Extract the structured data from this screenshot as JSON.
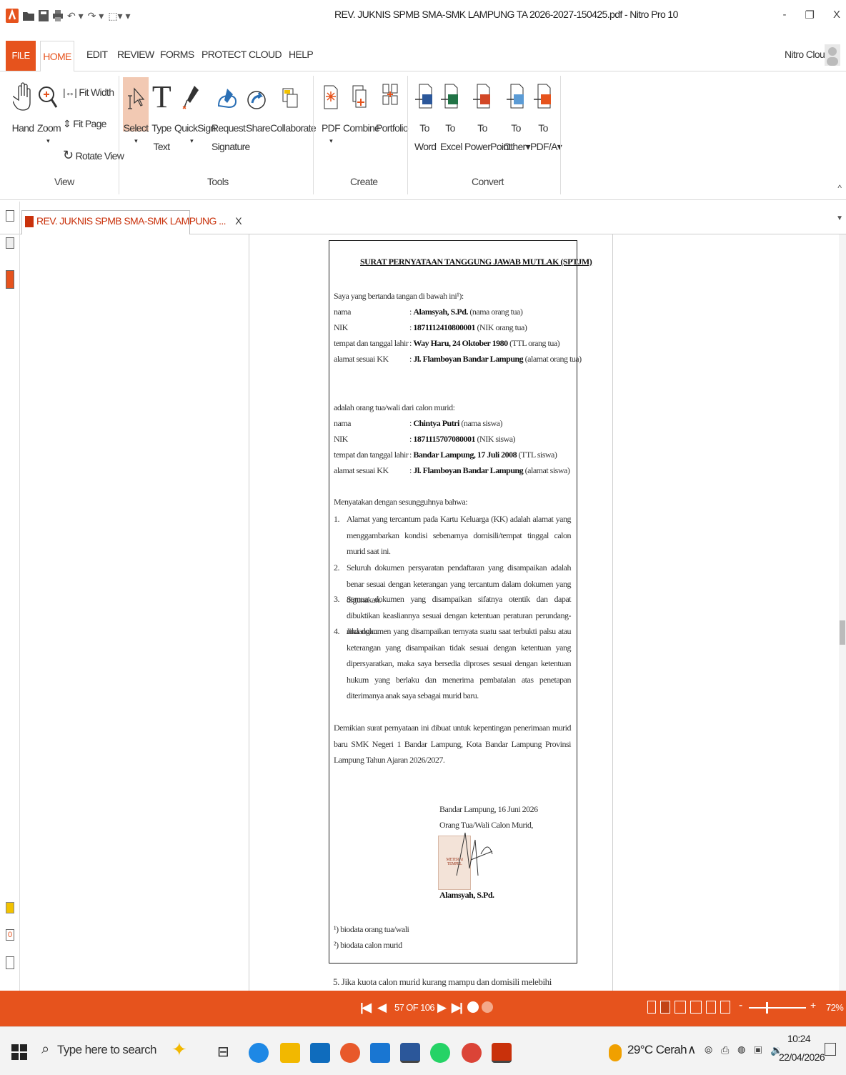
{
  "window": {
    "title": "REV. JUKNIS SPMB SMA-SMK LAMPUNG TA 2026-2027-150425.pdf - Nitro Pro 10",
    "minimize": "-",
    "restore": "❐",
    "close": "X"
  },
  "menu": {
    "file": "FILE",
    "tabs": [
      "HOME",
      "EDIT",
      "REVIEW",
      "FORMS",
      "PROTECT",
      "CLOUD",
      "HELP"
    ],
    "account": "Nitro Cloud"
  },
  "ribbon": {
    "view": {
      "label": "View",
      "hand": "Hand",
      "zoom": "Zoom",
      "fit_width": "Fit Width",
      "fit_page": "Fit Page",
      "rotate_view": "Rotate View"
    },
    "tools": {
      "label": "Tools",
      "select": "Select",
      "type_text": [
        "Type",
        "Text"
      ],
      "quicksign": "QuickSign",
      "request_signature": [
        "Request",
        "Signature"
      ],
      "share": "Share",
      "collaborate": "Collaborate"
    },
    "create": {
      "label": "Create",
      "pdf": "PDF",
      "combine": "Combine",
      "portfolio": "Portfolio"
    },
    "convert": {
      "label": "Convert",
      "to_word": [
        "To",
        "Word"
      ],
      "to_excel": [
        "To",
        "Excel"
      ],
      "to_powerpoint": [
        "To",
        "PowerPoint"
      ],
      "to_other": [
        "To",
        "Other▾"
      ],
      "to_pdfa": [
        "To",
        "PDF/A▾"
      ]
    }
  },
  "doc_tab": {
    "label": "REV. JUKNIS SPMB SMA-SMK LAMPUNG ...",
    "close": "X"
  },
  "document": {
    "title": "SURAT PERNYATAAN TANGGUNG JAWAB MUTLAK (SPTJM)",
    "intro": "Saya yang bertanda tangan di bawah ini¹):",
    "parent": [
      {
        "label": "nama",
        "value": "Alamsyah, S.Pd.",
        "note": "(nama orang tua)"
      },
      {
        "label": "NIK",
        "value": "1871112410800001",
        "note": "(NIK orang tua)"
      },
      {
        "label": "tempat dan tanggal lahir",
        "value": "Way Haru, 24 Oktober 1980",
        "note": "(TTL orang tua)"
      },
      {
        "label": "alamat sesuai KK",
        "value": "Jl. Flamboyan Bandar Lampung",
        "note": "(alamat orang tua)"
      }
    ],
    "child_intro": "adalah orang tua/wali dari calon murid:",
    "child": [
      {
        "label": "nama",
        "value": "Chintya Putri",
        "note": "(nama siswa)"
      },
      {
        "label": "NIK",
        "value": "1871115707080001",
        "note": "(NIK siswa)"
      },
      {
        "label": "tempat dan tanggal lahir",
        "value": "Bandar Lampung, 17 Juli 2008",
        "note": "(TTL siswa)"
      },
      {
        "label": "alamat sesuai KK",
        "value": "Jl. Flamboyan Bandar Lampung",
        "note": "(alamat siswa)"
      }
    ],
    "statement_intro": "Menyatakan dengan sesungguhnya bahwa:",
    "statements": [
      "Alamat yang tercantum pada Kartu Keluarga (KK) adalah alamat yang menggambarkan kondisi sebenarnya domisili/tempat tinggal calon murid saat ini.",
      "Seluruh dokumen persyaratan pendaftaran yang disampaikan adalah benar sesuai dengan keterangan yang tercantum dalam dokumen yang digunakan.",
      "Semua dokumen yang disampaikan sifatnya otentik dan dapat dibuktikan keasliannya sesuai dengan ketentuan peraturan perundang-undangan.",
      "Jika dokumen yang disampaikan ternyata suatu saat terbukti palsu atau keterangan yang disampaikan tidak sesuai dengan ketentuan yang dipersyaratkan, maka saya bersedia diproses sesuai dengan ketentuan hukum yang berlaku dan menerima pembatalan atas penetapan diterimanya anak saya sebagai murid baru."
    ],
    "closing": "Demikian surat pernyataan ini dibuat untuk kepentingan penerimaan murid baru SMK Negeri 1 Bandar Lampung, Kota Bandar Lampung Provinsi Lampung Tahun Ajaran 2026/2027.",
    "place_date": "Bandar Lampung, 16 Juni 2026",
    "signer_role": "Orang Tua/Wali Calon Murid,",
    "signer_name": "Alamsyah, S.Pd.",
    "stamp_text": [
      "METERAI",
      "TEMPEL"
    ],
    "footnote1": "¹) biodata orang tua/wali",
    "footnote2": "²) biodata calon murid",
    "next_line": "5.  Jika kuota calon murid kurang mampu dan domisili melebihi"
  },
  "status": {
    "page": "57 OF 106",
    "zoom": "72%"
  },
  "taskbar": {
    "search_placeholder": "Type here to search",
    "weather": "29°C  Cerah",
    "time": "10:24",
    "date": "22/04/2026"
  },
  "colors": {
    "accent": "#e6531d",
    "nitro_red": "#c9310b"
  }
}
